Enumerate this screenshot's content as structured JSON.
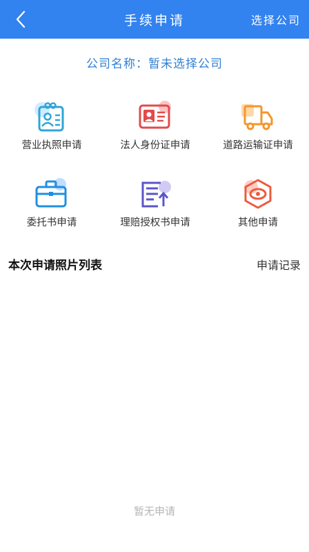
{
  "navbar": {
    "title": "手续申请",
    "action": "选择公司",
    "bg_color": "#3282f0"
  },
  "company": {
    "text": "公司名称：暂未选择公司",
    "color": "#2f7fd3"
  },
  "tiles": [
    {
      "label": "营业执照申请",
      "icon": "business-license-icon"
    },
    {
      "label": "法人身份证申请",
      "icon": "id-card-icon"
    },
    {
      "label": "道路运输证申请",
      "icon": "truck-icon"
    },
    {
      "label": "委托书申请",
      "icon": "briefcase-icon"
    },
    {
      "label": "理赔授权书申请",
      "icon": "document-upload-icon"
    },
    {
      "label": "其他申请",
      "icon": "hexagon-eye-icon"
    }
  ],
  "list": {
    "title": "本次申请照片列表",
    "record_link": "申请记录",
    "empty_text": "暂无申请"
  }
}
